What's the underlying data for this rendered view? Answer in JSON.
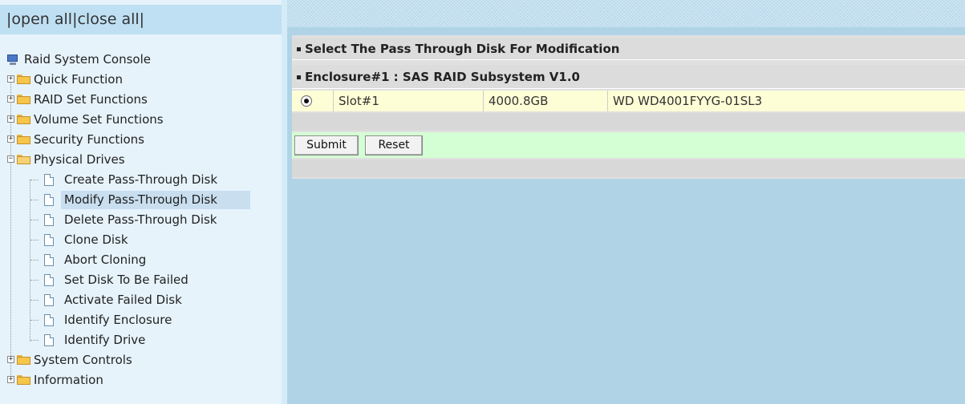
{
  "toolbar": {
    "prefix": "|",
    "open_all": "open all",
    "sep": "|",
    "close_all": "close all",
    "suffix": "|"
  },
  "tree": {
    "root": "Raid System Console",
    "folders": [
      {
        "label": "Quick Function"
      },
      {
        "label": "RAID Set Functions"
      },
      {
        "label": "Volume Set Functions"
      },
      {
        "label": "Security Functions"
      },
      {
        "label": "Physical Drives"
      },
      {
        "label": "System Controls"
      },
      {
        "label": "Information"
      }
    ],
    "physical_drives_items": [
      "Create Pass-Through Disk",
      "Modify Pass-Through Disk",
      "Delete Pass-Through Disk",
      "Clone Disk",
      "Abort Cloning",
      "Set Disk To Be Failed",
      "Activate Failed Disk",
      "Identify Enclosure",
      "Identify Drive"
    ],
    "selected_item": "Modify Pass-Through Disk"
  },
  "main": {
    "header": "Select The Pass Through Disk For Modification",
    "enclosure": "Enclosure#1 : SAS RAID Subsystem V1.0",
    "disk": {
      "slot": "Slot#1",
      "capacity": "4000.8GB",
      "model": "WD WD4001FYYG-01SL3",
      "selected": true
    },
    "submit_label": "Submit",
    "reset_label": "Reset"
  }
}
